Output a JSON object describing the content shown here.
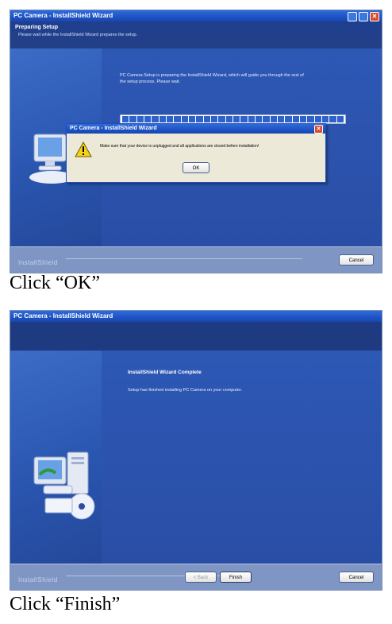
{
  "screenshot1": {
    "window_title": "PC Camera - InstallShield Wizard",
    "header_title": "Preparing Setup",
    "header_subtitle": "Please wait while the InstallShield Wizard prepares the setup.",
    "body_text_line1": "PC Camera Setup is preparing the InstallShield Wizard, which will guide you through the rest of",
    "body_text_line2": "the setup process. Please wait.",
    "brand": "InstallShield",
    "cancel_label": "Cancel",
    "dialog": {
      "title": "PC Camera - InstallShield Wizard",
      "message": "Make sure that your device is unplugged and all applications are closed before installation!",
      "ok_label": "OK",
      "close_glyph": "✕"
    }
  },
  "caption1": "Click “OK”",
  "screenshot2": {
    "window_title": "PC Camera - InstallShield Wizard",
    "complete_title": "InstallShield Wizard Complete",
    "complete_text": "Setup has finished installing PC Camera on your computer.",
    "brand": "InstallShield",
    "back_label": "< Back",
    "finish_label": "Finish",
    "cancel_label": "Cancel"
  },
  "caption2": "Click “Finish”",
  "colors": {
    "titlebar_blue": "#1d52c4",
    "wizard_blue": "#2c4c9c",
    "close_red": "#d84a2a",
    "dialog_bg": "#ece9d8"
  }
}
